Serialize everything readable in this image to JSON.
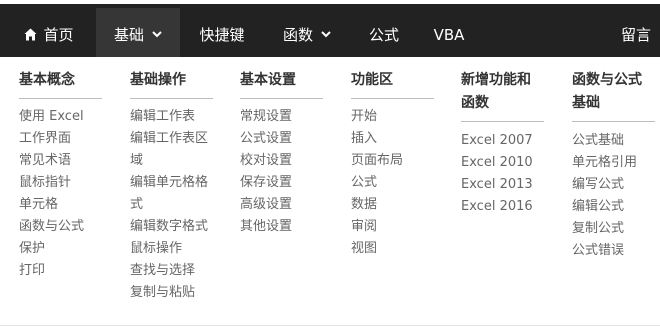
{
  "nav": {
    "items": [
      {
        "label": "首页",
        "icon": "home-icon"
      },
      {
        "label": "基础",
        "icon": "chevron-down-icon"
      },
      {
        "label": "快捷键"
      },
      {
        "label": "函数",
        "icon": "chevron-down-icon"
      },
      {
        "label": "公式"
      },
      {
        "label": "VBA"
      },
      {
        "label": "留言"
      }
    ],
    "colors": {
      "bar": "#222222",
      "active": "#363636",
      "text": "#ffffff"
    }
  },
  "dropdown": {
    "columns": [
      {
        "heading": "基本概念",
        "links": [
          "使用 Excel",
          "工作界面",
          "常见术语",
          "鼠标指针",
          "单元格",
          "函数与公式",
          "保护",
          "打印"
        ]
      },
      {
        "heading": "基础操作",
        "links": [
          "编辑工作表",
          "编辑工作表区域",
          "编辑单元格格式",
          "编辑数字格式",
          "鼠标操作",
          "查找与选择",
          "复制与粘贴"
        ]
      },
      {
        "heading": "基本设置",
        "links": [
          "常规设置",
          "公式设置",
          "校对设置",
          "保存设置",
          "高级设置",
          "其他设置"
        ]
      },
      {
        "heading": "功能区",
        "links": [
          "开始",
          "插入",
          "页面布局",
          "公式",
          "数据",
          "审阅",
          "视图"
        ]
      },
      {
        "heading": "新增功能和函数",
        "links": [
          "Excel 2007",
          "Excel 2010",
          "Excel 2013",
          "Excel 2016"
        ]
      },
      {
        "heading": "函数与公式基础",
        "links": [
          "公式基础",
          "单元格引用",
          "编写公式",
          "编辑公式",
          "复制公式",
          "公式错误"
        ]
      }
    ]
  }
}
